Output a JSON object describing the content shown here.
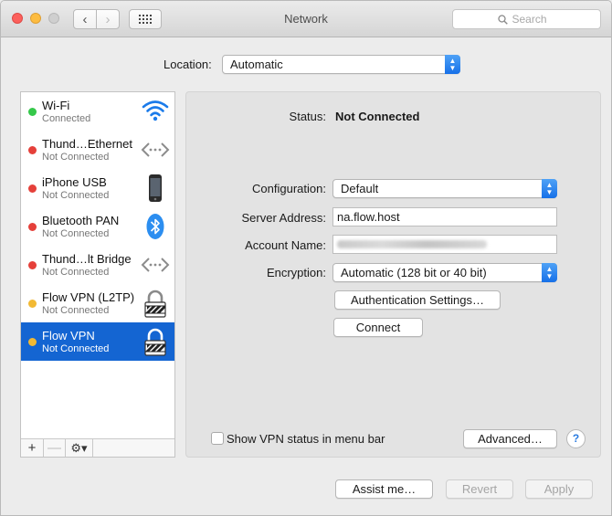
{
  "window": {
    "title": "Network",
    "search_placeholder": "Search",
    "back_glyph": "‹",
    "forward_glyph": "›"
  },
  "location": {
    "label": "Location:",
    "value": "Automatic"
  },
  "services": [
    {
      "name": "Wi-Fi",
      "status": "Connected",
      "dot_color": "#35c84a",
      "icon": "wifi-icon"
    },
    {
      "name": "Thund…Ethernet",
      "status": "Not Connected",
      "dot_color": "#e5403a",
      "icon": "ethernet-icon"
    },
    {
      "name": "iPhone USB",
      "status": "Not Connected",
      "dot_color": "#e5403a",
      "icon": "iphone-icon"
    },
    {
      "name": "Bluetooth PAN",
      "status": "Not Connected",
      "dot_color": "#e5403a",
      "icon": "bluetooth-icon"
    },
    {
      "name": "Thund…lt Bridge",
      "status": "Not Connected",
      "dot_color": "#e5403a",
      "icon": "bridge-icon"
    },
    {
      "name": "Flow VPN (L2TP)",
      "status": "Not Connected",
      "dot_color": "#f2b933",
      "icon": "vpn-lock-icon"
    },
    {
      "name": "Flow VPN",
      "status": "Not Connected",
      "dot_color": "#f2b933",
      "icon": "vpn-lock-icon",
      "selected": true
    }
  ],
  "sidebar_toolbar": {
    "add": "+",
    "remove": "—",
    "gear": "⚙▾"
  },
  "detail": {
    "status_label": "Status:",
    "status_value": "Not Connected",
    "configuration_label": "Configuration:",
    "configuration_value": "Default",
    "server_label": "Server Address:",
    "server_value": "na.flow.host",
    "account_label": "Account Name:",
    "encryption_label": "Encryption:",
    "encryption_value": "Automatic (128 bit or 40 bit)",
    "auth_button": "Authentication Settings…",
    "connect_button": "Connect",
    "show_status_label": "Show VPN status in menu bar",
    "show_status_checked": false,
    "advanced_button": "Advanced…",
    "help": "?"
  },
  "footer": {
    "assist_button": "Assist me…",
    "revert_button": "Revert",
    "apply_button": "Apply"
  },
  "colors": {
    "selection": "#1465d2",
    "accent": "#1670e8"
  }
}
